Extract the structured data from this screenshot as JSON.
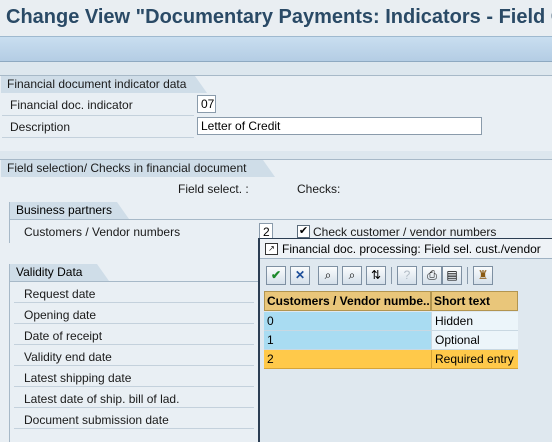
{
  "header": {
    "title": "Change View \"Documentary Payments: Indicators - Field Ct"
  },
  "indicator_group": {
    "title": "Financial document indicator data",
    "rows": [
      {
        "label": "Financial doc. indicator",
        "value": "07"
      },
      {
        "label": "Description",
        "value": "Letter of Credit"
      }
    ]
  },
  "field_selection_group": {
    "title": "Field selection/ Checks in financial document",
    "col_field_select": "Field select. :",
    "col_checks": "Checks:",
    "business_partners": {
      "title": "Business partners",
      "row_label": "Customers / Vendor numbers",
      "value": "2",
      "checkbox_label": "Check customer / vendor numbers",
      "checked": true
    },
    "validity": {
      "title": "Validity Data",
      "rows": [
        "Request date",
        "Opening date",
        "Date of receipt",
        "Validity end date",
        "Latest shipping date",
        "Latest date of ship. bill of lad.",
        "Document submission date"
      ]
    }
  },
  "popup": {
    "title": "Financial doc. processing: Field sel. cust./vendor",
    "toolbar": [
      {
        "name": "confirm-button",
        "glyph": "✔",
        "enabled": true
      },
      {
        "name": "cancel-button",
        "glyph": "✕",
        "enabled": true
      },
      {
        "name": "find-button",
        "glyph": "⌕",
        "enabled": true
      },
      {
        "name": "find-next-button",
        "glyph": "⌕",
        "enabled": true
      },
      {
        "name": "sort-button",
        "glyph": "⇅",
        "enabled": true
      },
      {
        "name": "help-button",
        "glyph": "?",
        "enabled": false
      },
      {
        "name": "print-button",
        "glyph": "⎙",
        "enabled": true
      },
      {
        "name": "layout-button",
        "glyph": "▤",
        "enabled": true
      },
      {
        "name": "technical-info-button",
        "glyph": "♜",
        "enabled": true
      }
    ],
    "columns": [
      "Customers / Vendor numbe...",
      "Short text"
    ],
    "rows": [
      {
        "key": "0",
        "text": "Hidden",
        "selected": false
      },
      {
        "key": "1",
        "text": "Optional",
        "selected": false
      },
      {
        "key": "2",
        "text": "Required entry",
        "selected": true
      }
    ]
  },
  "colors": {
    "title": "#2a4a66",
    "selection": "#ffc94a",
    "header_cell": "#e9c67a",
    "key_cell": "#a9dcf2"
  }
}
